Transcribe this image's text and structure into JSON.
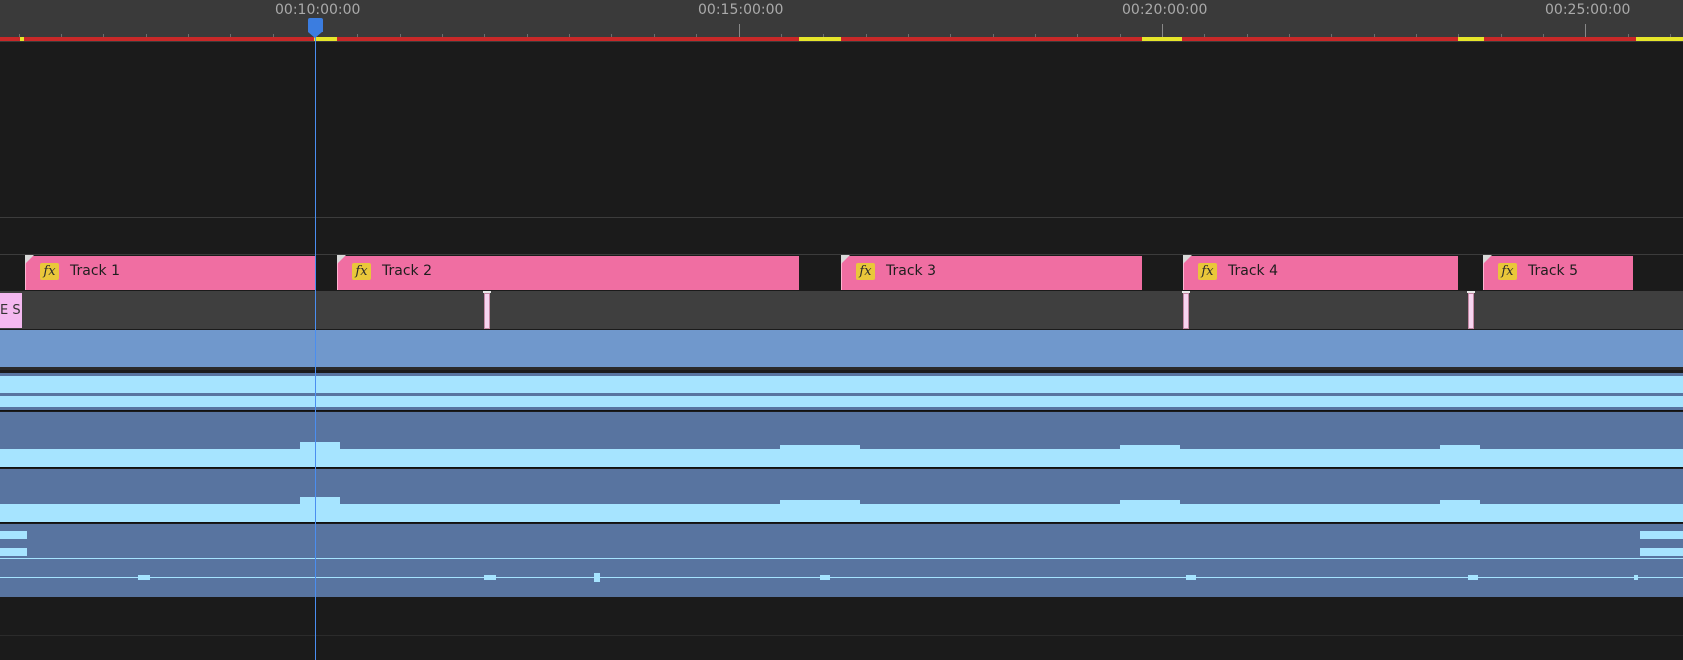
{
  "ruler": {
    "labels": [
      "00:10:00:00",
      "00:15:00:00",
      "00:20:00:00",
      "00:25:00:00"
    ]
  },
  "playhead": {
    "time": "00:10:00:00"
  },
  "colors": {
    "clip": "#f06ea2",
    "fx_badge": "#e9c73a",
    "playhead": "#3b7de0",
    "render_red": "#c82828",
    "render_yellow": "#e6e62a",
    "audio_bg": "#5874a0",
    "audio_wave": "#a6e4ff",
    "video_track": "#7098cc"
  },
  "clips": [
    {
      "name": "Track 1",
      "fx": "fx"
    },
    {
      "name": "Track 2",
      "fx": "fx"
    },
    {
      "name": "Track 3",
      "fx": "fx"
    },
    {
      "name": "Track 4",
      "fx": "fx"
    },
    {
      "name": "Track 5",
      "fx": "fx"
    }
  ],
  "left_chip": {
    "label": "E S"
  },
  "icons": [
    "fx-badge-icon",
    "playhead-icon",
    "marker-icon",
    "clip-corner-icon"
  ]
}
